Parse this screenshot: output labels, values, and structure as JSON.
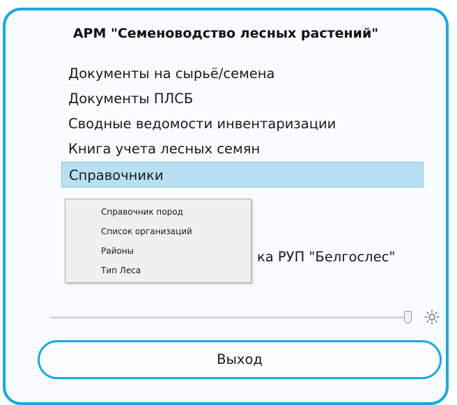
{
  "app": {
    "title": "АРМ \"Семеноводство лесных растений\""
  },
  "menu": {
    "items": [
      {
        "label": "Документы на сырьё/семена"
      },
      {
        "label": "Документы ПЛСБ"
      },
      {
        "label": "Сводные ведомости инвентаризации"
      },
      {
        "label": "Книга учета лесных семян"
      },
      {
        "label": "Справочники",
        "selected": true
      }
    ],
    "partially_hidden_label": "ка РУП \"Белгослес\""
  },
  "submenu": {
    "items": [
      {
        "label": "Справочник пород"
      },
      {
        "label": "Список организаций"
      },
      {
        "label": "Районы"
      },
      {
        "label": "Тип Леса"
      }
    ]
  },
  "brightness": {
    "level_percent": 100,
    "icon": "sun-icon"
  },
  "footer": {
    "exit_label": "Выход"
  },
  "colors": {
    "accent": "#17a9e2",
    "selection": "#b9dff3"
  }
}
